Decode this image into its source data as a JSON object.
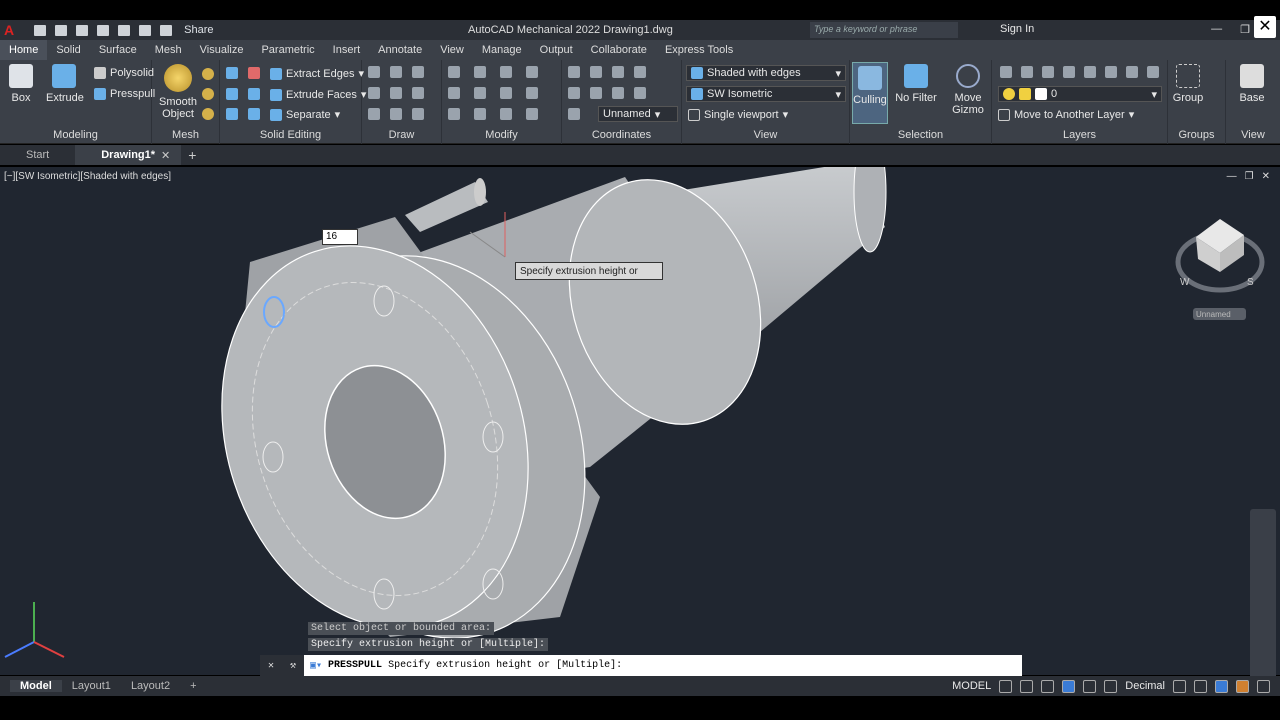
{
  "app": {
    "title": "AutoCAD Mechanical 2022  Drawing1.dwg",
    "share": "Share",
    "search_placeholder": "Type a keyword or phrase",
    "sign_in": "Sign In"
  },
  "ribbon_tabs": [
    "Home",
    "Solid",
    "Surface",
    "Mesh",
    "Visualize",
    "Parametric",
    "Insert",
    "Annotate",
    "View",
    "Manage",
    "Output",
    "Collaborate",
    "Express Tools"
  ],
  "panels": {
    "modeling": {
      "title": "Modeling",
      "box": "Box",
      "extrude": "Extrude",
      "polysolid": "Polysolid",
      "presspull": "Presspull"
    },
    "mesh": {
      "title": "Mesh",
      "smooth": "Smooth Object"
    },
    "solid_editing": {
      "title": "Solid Editing",
      "extract_edges": "Extract Edges",
      "extrude_faces": "Extrude Faces",
      "separate": "Separate"
    },
    "draw": {
      "title": "Draw"
    },
    "modify": {
      "title": "Modify"
    },
    "coordinates": {
      "title": "Coordinates",
      "ucs": "Unnamed"
    },
    "view": {
      "title": "View",
      "visual_style": "Shaded with edges",
      "view_name": "SW Isometric",
      "viewport": "Single viewport"
    },
    "selection": {
      "title": "Selection",
      "culling": "Culling",
      "no_filter": "No Filter",
      "move_gizmo": "Move Gizmo"
    },
    "layers": {
      "title": "Layers",
      "layer": "0",
      "move_layer": "Move to Another Layer"
    },
    "groups": {
      "title": "Groups",
      "group": "Group"
    },
    "view2": {
      "title": "View",
      "base": "Base"
    }
  },
  "file_tabs": [
    "Start",
    "Drawing1*"
  ],
  "viewport": {
    "label": "[−][SW Isometric][Shaded with edges]",
    "tooltip": "Specify extrusion height or",
    "dim_value": "16",
    "viewcube_label": "Unnamed"
  },
  "command": {
    "history": [
      "Select object or bounded area:",
      "Specify extrusion height or [Multiple]:"
    ],
    "current_cmd": "PRESSPULL",
    "current_text": "Specify extrusion height or [Multiple]:"
  },
  "layout_tabs": [
    "Model",
    "Layout1",
    "Layout2"
  ],
  "status": {
    "model": "MODEL",
    "units": "Decimal"
  }
}
